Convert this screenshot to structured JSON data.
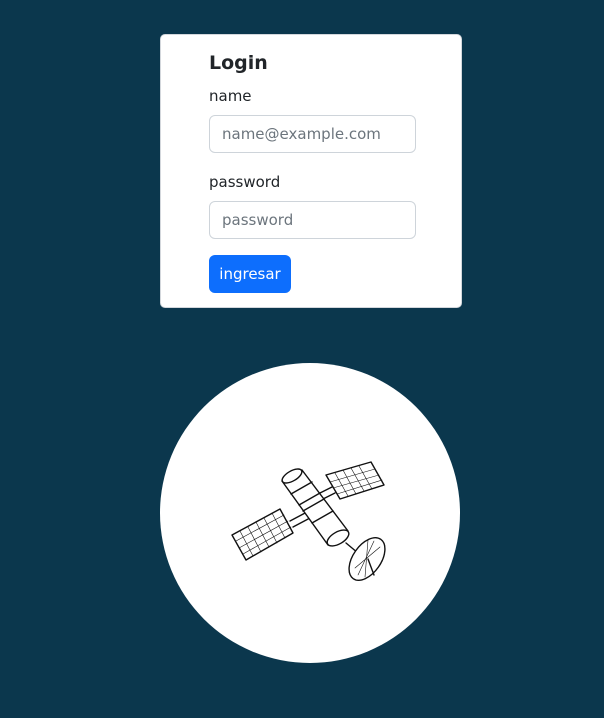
{
  "login": {
    "title": "Login",
    "name_label": "name",
    "name_placeholder": "name@example.com",
    "password_label": "password",
    "password_placeholder": "password",
    "submit_label": "ingresar"
  },
  "illustration": {
    "icon": "satellite-icon"
  },
  "colors": {
    "background": "#0b374d",
    "primary": "#0d6efd",
    "card": "#ffffff"
  }
}
